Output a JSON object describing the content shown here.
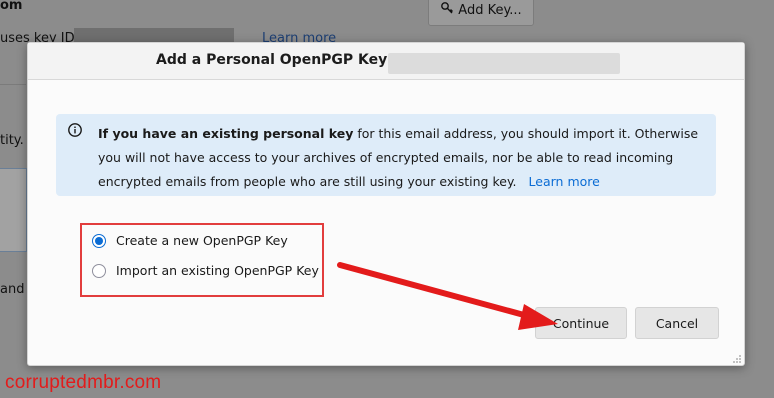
{
  "background": {
    "line1_prefix": "om",
    "line2_prefix": "uses key ID",
    "learn_more": "Learn more",
    "add_key_button": "Add Key...",
    "line3_prefix": "tity.",
    "line4_prefix": "and"
  },
  "dialog": {
    "title": "Add a Personal OpenPGP Key for",
    "info": {
      "bold_text": "If you have an existing personal key",
      "text": " for this email address, you should import it. Otherwise you will not have access to your archives of encrypted emails, nor be able to read incoming encrypted emails from people who are still using your existing key.",
      "link": "Learn more"
    },
    "options": [
      {
        "label": "Create a new OpenPGP Key",
        "checked": true
      },
      {
        "label": "Import an existing OpenPGP Key",
        "checked": false
      }
    ],
    "continue_label": "Continue",
    "cancel_label": "Cancel"
  },
  "watermark": "corruptedmbr.com",
  "colors": {
    "accent": "#0b6cd4",
    "annotation_red": "#e23d3d",
    "info_bg": "#deecf9"
  }
}
